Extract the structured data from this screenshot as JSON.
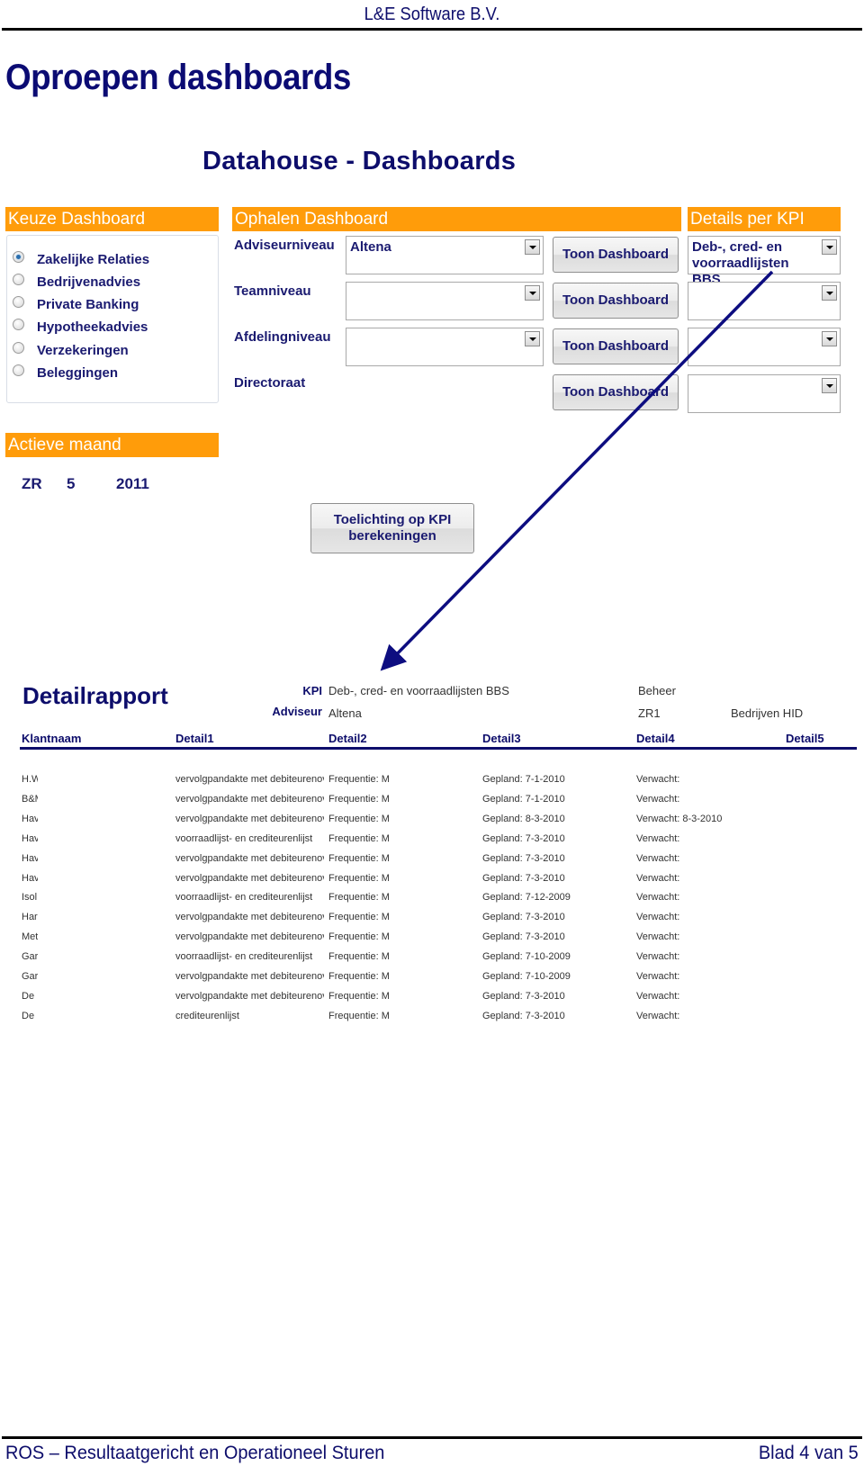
{
  "page": {
    "company": "L&E Software B.V.",
    "title": "Oproepen dashboards",
    "footer_left": "ROS – Resultaatgericht en Operationeel Sturen",
    "footer_right": "Blad 4 van 5"
  },
  "app": {
    "title": "Datahouse - Dashboards",
    "keuze": {
      "header": "Keuze Dashboard",
      "options": [
        {
          "label": "Zakelijke Relaties",
          "checked": true
        },
        {
          "label": "Bedrijvenadvies",
          "checked": false
        },
        {
          "label": "Private Banking",
          "checked": false
        },
        {
          "label": "Hypotheekadvies",
          "checked": false
        },
        {
          "label": "Verzekeringen",
          "checked": false
        },
        {
          "label": "Beleggingen",
          "checked": false
        }
      ]
    },
    "ophalen": {
      "header": "Ophalen Dashboard",
      "levels": [
        {
          "label": "Adviseurniveau",
          "value": "Altena",
          "button": "Toon Dashboard"
        },
        {
          "label": "Teamniveau",
          "value": "",
          "button": "Toon Dashboard"
        },
        {
          "label": "Afdelingniveau",
          "value": "",
          "button": "Toon Dashboard"
        },
        {
          "label": "Directoraat",
          "button": "Toon Dashboard"
        }
      ]
    },
    "details": {
      "header": "Details per KPI",
      "combos": [
        "Deb-, cred- en voorraadlijsten BBS",
        "",
        "",
        ""
      ]
    },
    "actieve": {
      "header": "Actieve maand",
      "region": "ZR",
      "month": "5",
      "year": "2011"
    },
    "toelichting_button": "Toelichting op KPI berekeningen",
    "accent_color": "#ff9c0a",
    "text_color": "#1a1a70",
    "arrow_color": "#0d0d80"
  },
  "report": {
    "title": "Detailrapport",
    "kpi_label": "KPI",
    "kpi_value": "Deb-, cred- en voorraadlijsten BBS",
    "beheer": "Beheer",
    "adviseur_label": "Adviseur",
    "adviseur_value": "Altena",
    "region": "ZR1",
    "unit": "Bedrijven HID",
    "columns": [
      "Klantnaam",
      "Detail1",
      "Detail2",
      "Detail3",
      "Detail4",
      "Detail5"
    ],
    "rows": [
      [
        "H.W",
        "vervolgpandakte met debiteurenov",
        "Frequentie: M",
        "Gepland: 7-1-2010",
        "Verwacht:"
      ],
      [
        "B&M",
        "vervolgpandakte met debiteurenov",
        "Frequentie: M",
        "Gepland: 7-1-2010",
        "Verwacht:"
      ],
      [
        "Hav",
        "vervolgpandakte met debiteurenov",
        "Frequentie: M",
        "Gepland: 8-3-2010",
        "Verwacht: 8-3-2010"
      ],
      [
        "Hav",
        "voorraadlijst- en crediteurenlijst",
        "Frequentie: M",
        "Gepland: 7-3-2010",
        "Verwacht:"
      ],
      [
        "Hav",
        "vervolgpandakte met debiteurenov",
        "Frequentie: M",
        "Gepland: 7-3-2010",
        "Verwacht:"
      ],
      [
        "Hav",
        "vervolgpandakte met debiteurenov",
        "Frequentie: M",
        "Gepland: 7-3-2010",
        "Verwacht:"
      ],
      [
        "Isol",
        "voorraadlijst- en crediteurenlijst",
        "Frequentie: M",
        "Gepland: 7-12-2009",
        "Verwacht:"
      ],
      [
        "Har",
        "vervolgpandakte met debiteurenov",
        "Frequentie: M",
        "Gepland: 7-3-2010",
        "Verwacht:"
      ],
      [
        "Met",
        "vervolgpandakte met debiteurenov",
        "Frequentie: M",
        "Gepland: 7-3-2010",
        "Verwacht:"
      ],
      [
        "Gar",
        "voorraadlijst- en crediteurenlijst",
        "Frequentie: M",
        "Gepland: 7-10-2009",
        "Verwacht:"
      ],
      [
        "Gar",
        "vervolgpandakte met debiteurenov",
        "Frequentie: M",
        "Gepland: 7-10-2009",
        "Verwacht:"
      ],
      [
        "De",
        "vervolgpandakte met debiteurenov",
        "Frequentie: M",
        "Gepland: 7-3-2010",
        "Verwacht:"
      ],
      [
        "De",
        "crediteurenlijst",
        "Frequentie: M",
        "Gepland: 7-3-2010",
        "Verwacht:"
      ]
    ]
  }
}
